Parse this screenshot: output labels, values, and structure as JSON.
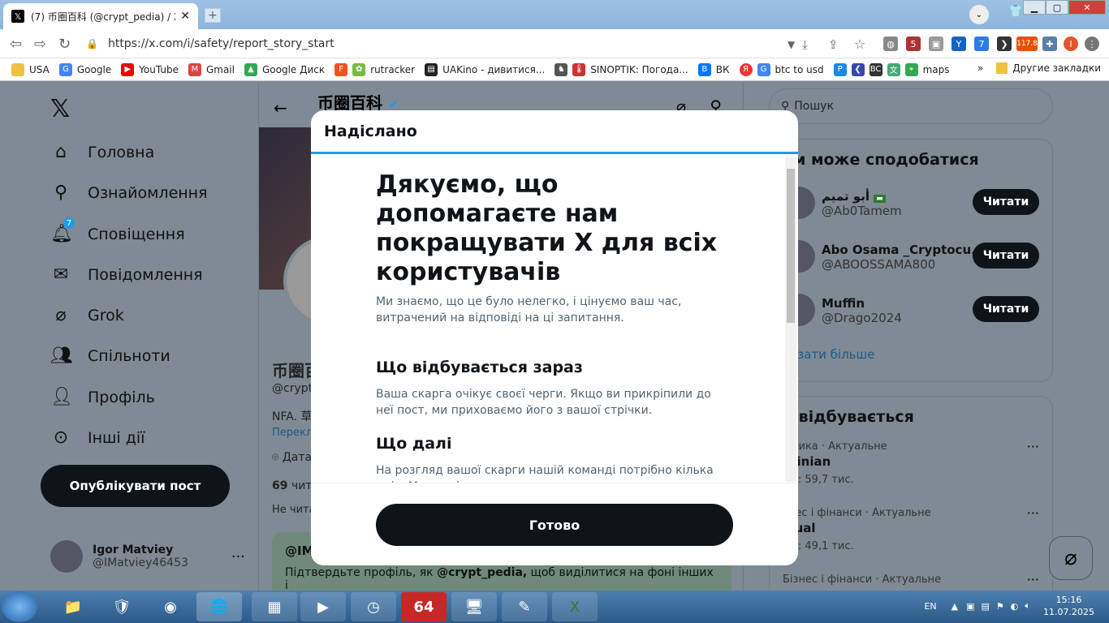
{
  "browser": {
    "tab_title": "(7) 币圈百科 (@crypt_pedia) / X",
    "url": "https://x.com/i/safety/report_story_start",
    "bookmarks": [
      "USA",
      "Google",
      "YouTube",
      "Gmail",
      "Google Диск",
      "rutracker",
      "UAKino - дивитися...",
      "SINOPTIK: Погода...",
      "ВК",
      "btc to usd",
      "maps"
    ],
    "other_bookmarks": "Другие закладки",
    "ext_badge_1": "5",
    "ext_badge_2": "7",
    "ext_badge_3": "117.8"
  },
  "leftnav": {
    "items": [
      "Головна",
      "Ознайомлення",
      "Сповіщення",
      "Повідомлення",
      "Grok",
      "Спільноти",
      "Профіль",
      "Інші дії"
    ],
    "notif_badge": "7",
    "post_button": "Опублікувати пост",
    "user_name": "Igor Matviey",
    "user_handle": "@IMatviey46453"
  },
  "profile": {
    "name": "币圈百科",
    "name_partial": "币圈百",
    "handle_partial": "@crypt",
    "bio_partial": "NFA. 草",
    "translate_partial": "Перекла",
    "date_partial": "Дата",
    "following_count": "69",
    "following_partial": "чита",
    "not_following_partial": "Не читае",
    "verify_handle_partial": "@IM",
    "verify_text_1": "Підтвердьте профіль, як",
    "verify_handle": "@crypt_pedia,",
    "verify_text_2": "щоб виділитися на фоні інших і"
  },
  "right": {
    "search_placeholder": "Пошук",
    "wtf_title": "ам може сподобатися",
    "accounts": [
      {
        "name": "أبو تميم",
        "handle": "@Ab0Tamem"
      },
      {
        "name": "Abo Osama _Cryptocu...",
        "handle": "@ABOOSSAMA800"
      },
      {
        "name": "Muffin",
        "handle": "@Drago2024"
      }
    ],
    "follow_label": "Читати",
    "show_more": "казати більше",
    "trends_title": "о відбувається",
    "trends": [
      {
        "category": "літика · Актуальне",
        "title": "rainian",
        "count": "тів: 59,7 тис."
      },
      {
        "category": "знес і фінанси · Актуальне",
        "title": "rtual",
        "count": "тів: 49,1 тис."
      },
      {
        "category": "Бізнес і фінанси · Актуальне",
        "title": "",
        "count": ""
      }
    ]
  },
  "modal": {
    "header": "Надіслано",
    "title": "Дякуємо, що допомагаєте нам покращувати X для всіх користувачів",
    "intro": "Ми знаємо, що це було нелегко, і цінуємо ваш час, витрачений на відповіді на ці запитання.",
    "now_heading": "Що відбувається зараз",
    "now_text": "Ваша скарга очікує своєї черги. Якщо ви прикріпили до неї пост, ми приховаємо його з вашої стрічки.",
    "next_heading": "Що далі",
    "next_text": "На розгляд вашої скарги нашій команді потрібно кілька днів. Ми сповістимо вас, якщо виявимо порушення правил, і повідомимо, яких заходів вживаємо.",
    "done_button": "Готово"
  },
  "taskbar": {
    "lang": "EN",
    "time": "15:16",
    "date": "11.07.2025",
    "app_64": "64"
  }
}
